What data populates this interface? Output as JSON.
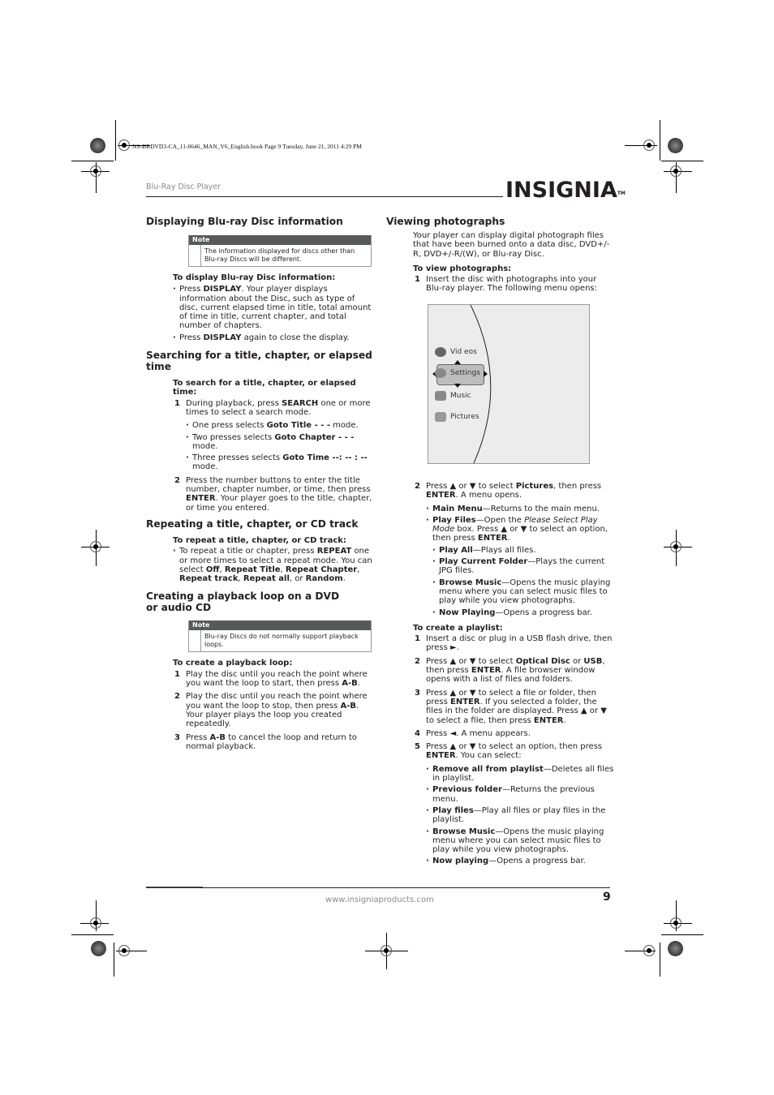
{
  "slug": "NS-BRDVD3-CA_11-0646_MAN_V6_English.book  Page 9  Tuesday, June 21, 2011  4:29 PM",
  "header": {
    "running_head": "Blu-Ray Disc Player",
    "logo_text": "INSIGNIA",
    "logo_tm": "TM"
  },
  "left": {
    "s1": {
      "title": "Displaying Blu-ray Disc information",
      "note_label": "Note",
      "note_text": "The information displayed for discs other than Blu-ray Discs will be different.",
      "sub": "To display Blu-ray Disc information:",
      "b1_a": "Press ",
      "b1_b": "DISPLAY",
      "b1_c": ". Your player displays information about the Disc, such as type of disc, current elapsed time in title, total amount of time in title, current chapter, and total number of chapters.",
      "b2_a": "Press ",
      "b2_b": "DISPLAY",
      "b2_c": " again to close the display."
    },
    "s2": {
      "title": "Searching for a title, chapter, or elapsed time",
      "sub": "To search for a title, chapter, or elapsed time:",
      "step1_a": "During playback, press ",
      "step1_b": "SEARCH",
      "step1_c": " one or more times to select a search mode.",
      "opt1_a": "One press selects ",
      "opt1_b": "Goto Title - - -",
      "opt1_c": " mode.",
      "opt2_a": "Two presses selects ",
      "opt2_b": "Goto Chapter - - -",
      "opt2_c": " mode.",
      "opt3_a": "Three presses selects ",
      "opt3_b": "Goto Time --: -- : --",
      "opt3_c": " mode.",
      "step2_a": "Press the number buttons to enter the title number, chapter number, or time, then press ",
      "step2_b": "ENTER",
      "step2_c": ". Your player goes to the title, chapter, or time you entered."
    },
    "s3": {
      "title": "Repeating a title, chapter, or CD track",
      "sub": "To repeat a title, chapter, or CD track:",
      "b1": [
        "To repeat a title or chapter, press ",
        "REPEAT",
        " one or more times to select a repeat mode. You can select ",
        "Off",
        ", ",
        "Repeat Title",
        ", ",
        "Repeat Chapter",
        ", ",
        "Repeat track",
        ", ",
        "Repeat all",
        ", or ",
        "Random",
        "."
      ]
    },
    "s4": {
      "title": "Creating a playback loop on a DVD or audio CD",
      "note_label": "Note",
      "note_text": "Blu-ray Discs do not normally support playback loops.",
      "sub": "To create a playback loop:",
      "step1_a": "Play the disc until you reach the point where you want the loop to start, then press ",
      "step1_b": "A-B",
      "step1_c": ".",
      "step2_a": "Play the disc until you reach the point where you want the loop to stop, then press ",
      "step2_b": "A-B",
      "step2_c": ". Your player plays the loop you created repeatedly.",
      "step3_a": "Press ",
      "step3_b": "A-B",
      "step3_c": " to cancel the loop and return to normal playback."
    }
  },
  "right": {
    "title": "Viewing photographs",
    "intro": "Your player can display digital photograph files that have been burned onto a data disc, DVD+/-R, DVD+/-R/(W), or Blu-ray Disc.",
    "sub1": "To view photographs:",
    "step1": "Insert the disc with photographs into your Blu-ray player. The following menu opens:",
    "menu": {
      "items": [
        "Vid eos",
        "Settings",
        "Music",
        "Pictures"
      ],
      "selected": "Settings"
    },
    "step2": [
      "Press ",
      "▲",
      " or ",
      "▼",
      " to select ",
      "Pictures",
      ", then press ",
      "ENTER",
      ". A menu opens."
    ],
    "step2_opts": [
      {
        "b": "Main Menu",
        "t": "—Returns to the main menu."
      },
      {
        "b": "Play Files",
        "t": "—Open the ",
        "i": "Please Select Play Mode",
        "t2": " box. Press ▲ or ▼ to select an option, then press ",
        "b2": "ENTER",
        "t3": "."
      }
    ],
    "play_files_opts": [
      {
        "b": "Play All",
        "t": "—Plays all files."
      },
      {
        "b": "Play Current Folder",
        "t": "—Plays the current JPG files."
      },
      {
        "b": "Browse Music",
        "t": "—Opens the music playing menu where you can select music files to play while you view photographs."
      },
      {
        "b": "Now Playing",
        "t": "—Opens a progress bar."
      }
    ],
    "sub2": "To create a playlist:",
    "pl_step1": [
      "Insert a disc or plug in a USB flash drive, then press ",
      "►",
      "."
    ],
    "pl_step2": [
      "Press ▲  or ▼ to select ",
      "Optical Disc",
      " or ",
      "USB",
      ", then press ",
      "ENTER",
      ". A file browser window opens with a list of files and folders."
    ],
    "pl_step3": [
      "Press ▲  or ▼ to select a file or folder, then press ",
      "ENTER",
      ". If you selected a folder, the files in the folder are displayed. Press ▲  or ▼ to select a file, then press ",
      "ENTER",
      "."
    ],
    "pl_step4": "Press ◄. A menu appears.",
    "pl_step5": [
      "Press ▲  or ▼ to select an option, then press ",
      "ENTER",
      ". You can select:"
    ],
    "pl_opts": [
      {
        "b": "Remove all from playlist",
        "t": "—Deletes all files in playlist."
      },
      {
        "b": "Previous folder",
        "t": "—Returns the previous menu."
      },
      {
        "b": "Play files",
        "t": "—Play all files or play files in the playlist."
      },
      {
        "b": "Browse Music",
        "t": "—Opens the music playing menu where you can select music files to play while you view photographs."
      },
      {
        "b": "Now playing",
        "t": "—Opens a progress bar."
      }
    ]
  },
  "footer": {
    "url": "www.insigniaproducts.com",
    "page_number": "9"
  }
}
